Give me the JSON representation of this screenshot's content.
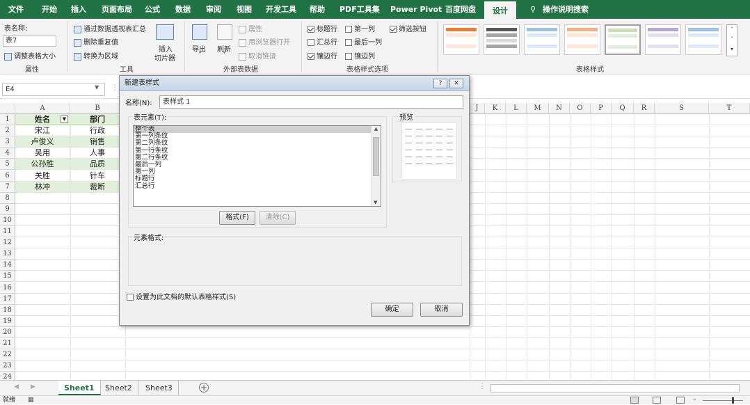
{
  "ribbon_tabs": [
    "文件",
    "开始",
    "插入",
    "页面布局",
    "公式",
    "数据",
    "审阅",
    "视图",
    "开发工具",
    "帮助",
    "PDF工具集",
    "Power Pivot",
    "百度网盘",
    "设计"
  ],
  "active_tab": "设计",
  "tell_me": "操作说明搜索",
  "ribbon": {
    "properties": {
      "table_name_label": "表名称:",
      "table_name_value": "表7",
      "resize_label": "调整表格大小",
      "group": "属性"
    },
    "tools": {
      "pivot": "通过数据透视表汇总",
      "remove_dup": "删除重复值",
      "convert": "转换为区域",
      "slicer_line1": "插入",
      "slicer_line2": "切片器",
      "group": "工具"
    },
    "external": {
      "export": "导出",
      "refresh": "刷新",
      "properties": "属性",
      "open_browser": "用浏览器打开",
      "unlink": "取消链接",
      "group": "外部表数据"
    },
    "style_options": {
      "header_row": "标题行",
      "first_column": "第一列",
      "filter_button": "筛选按钮",
      "total_row": "汇总行",
      "last_column": "最后一列",
      "banded_rows": "镶边行",
      "banded_columns": "镶边列",
      "group": "表格样式选项"
    },
    "table_styles": {
      "group": "表格样式"
    }
  },
  "name_box": "E4",
  "columns": [
    "A",
    "B",
    "J",
    "K",
    "L",
    "M",
    "N",
    "O",
    "P",
    "Q",
    "R",
    "S",
    "T"
  ],
  "rows": [
    "1",
    "2",
    "3",
    "4",
    "5",
    "6",
    "7",
    "8",
    "9",
    "10",
    "11",
    "12",
    "13",
    "14",
    "15",
    "16",
    "17",
    "18",
    "19",
    "20",
    "21",
    "22",
    "23",
    "24"
  ],
  "table": {
    "headers": [
      "姓名",
      "部门"
    ],
    "rows": [
      [
        "宋江",
        "行政"
      ],
      [
        "卢俊义",
        "销售"
      ],
      [
        "吴用",
        "人事"
      ],
      [
        "公孙胜",
        "品质"
      ],
      [
        "关胜",
        "针车"
      ],
      [
        "林冲",
        "裁断"
      ]
    ]
  },
  "dialog": {
    "title": "新建表样式",
    "name_label": "名称(N):",
    "name_value": "表样式 1",
    "elements_label": "表元素(T):",
    "elements": [
      "整个表",
      "第一列条纹",
      "第二列条纹",
      "第一行条纹",
      "第二行条纹",
      "最后一列",
      "第一列",
      "标题行",
      "汇总行"
    ],
    "selected_element": "整个表",
    "preview_label": "预览",
    "format_button": "格式(F)",
    "clear_button": "清除(C)",
    "element_format_label": "元素格式:",
    "default_checkbox": "设置为此文档的默认表格样式(S)",
    "ok_button": "确定",
    "cancel_button": "取消",
    "help_glyph": "?",
    "close_glyph": "✕"
  },
  "sheets": [
    "Sheet1",
    "Sheet2",
    "Sheet3"
  ],
  "active_sheet": "Sheet1",
  "status": {
    "ready": "就绪"
  },
  "colors": {
    "excel_green": "#217346",
    "band": "#e2efda"
  }
}
